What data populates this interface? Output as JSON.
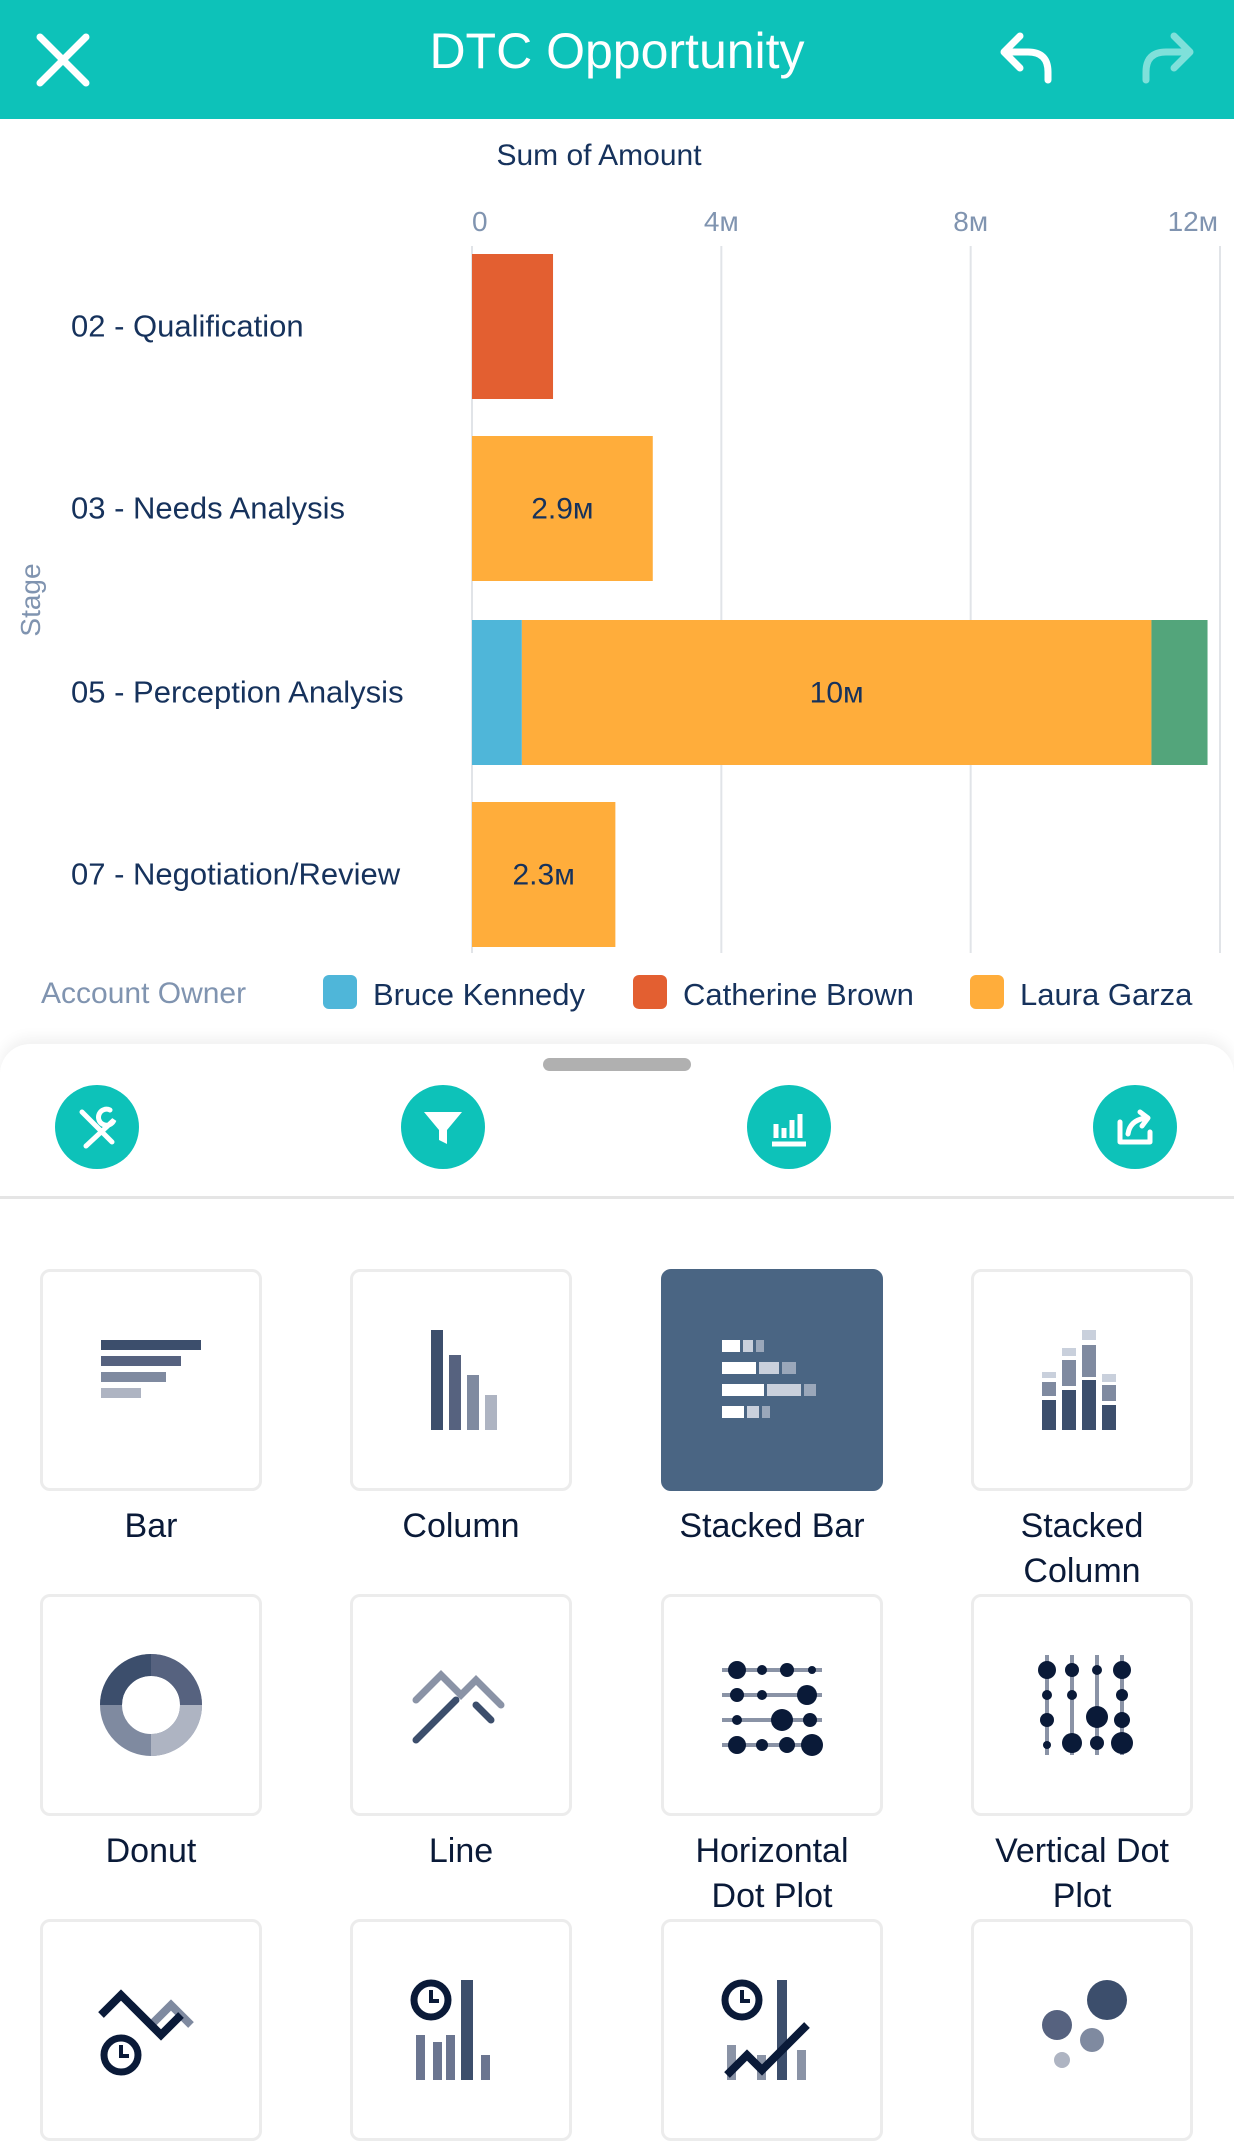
{
  "header": {
    "title": "DTC Opportunity",
    "close_icon": "close-icon",
    "undo_icon": "undo-icon",
    "redo_icon": "redo-icon"
  },
  "chart_data": {
    "type": "bar",
    "orientation": "horizontal",
    "stacked": true,
    "title": "Sum of Amount",
    "xlabel": "Sum of Amount",
    "ylabel": "Stage",
    "xlim": [
      0,
      12000000
    ],
    "x_ticks": [
      "0",
      "4м",
      "8м",
      "12м"
    ],
    "grid": true,
    "categories": [
      "02 - Qualification",
      "03 - Needs Analysis",
      "05 - Perception Analysis",
      "07 - Negotiation/Review"
    ],
    "series": [
      {
        "name": "Bruce Kennedy",
        "color": "#4fb6d9",
        "values": [
          0,
          0,
          0.8,
          0
        ]
      },
      {
        "name": "Catherine Brown",
        "color": "#e35f31",
        "values": [
          1.3,
          0,
          0,
          0
        ]
      },
      {
        "name": "Laura Garza",
        "color": "#ffad3b",
        "values": [
          0,
          2.9,
          10.1,
          2.3
        ]
      },
      {
        "color": "#53a57b",
        "values": [
          0,
          0,
          0.9,
          0
        ]
      }
    ],
    "value_unit": "M",
    "data_labels": [
      "",
      "2.9м",
      "10м",
      "2.3м"
    ],
    "legend_title": "Account Owner",
    "legend_position": "bottom"
  },
  "toolbar": [
    {
      "icon": "tools-icon"
    },
    {
      "icon": "filter-icon"
    },
    {
      "icon": "chart-icon"
    },
    {
      "icon": "share-icon"
    }
  ],
  "chart_types": [
    {
      "label": "Bar",
      "selected": false
    },
    {
      "label": "Column",
      "selected": false
    },
    {
      "label": "Stacked Bar",
      "selected": true
    },
    {
      "label": "Stacked Column",
      "selected": false
    },
    {
      "label": "Donut",
      "selected": false
    },
    {
      "label": "Line",
      "selected": false
    },
    {
      "label": "Horizontal Dot Plot",
      "selected": false
    },
    {
      "label": "Vertical Dot Plot",
      "selected": false
    },
    {
      "label": "",
      "selected": false
    },
    {
      "label": "",
      "selected": false
    },
    {
      "label": "",
      "selected": false
    },
    {
      "label": "",
      "selected": false
    }
  ],
  "colors": {
    "accent": "#0dc2b9",
    "selected_tile": "#4a6583"
  }
}
